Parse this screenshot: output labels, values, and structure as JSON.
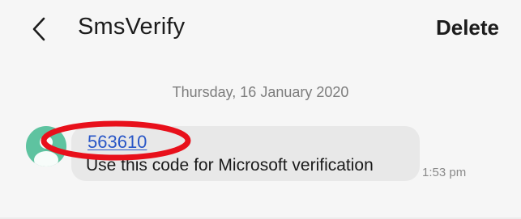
{
  "header": {
    "back_icon": "chevron-left-icon",
    "title": "SmsVerify",
    "delete_label": "Delete"
  },
  "conversation": {
    "date_divider": "Thursday, 16 January 2020",
    "messages": [
      {
        "sender_avatar_icon": "person-icon",
        "code": "563610",
        "text": "Use this code for Microsoft verification",
        "time": "1:53 pm"
      }
    ]
  },
  "annotation": {
    "type": "highlight-ellipse",
    "color": "#e8101b"
  },
  "colors": {
    "avatar": "#5ec3a0",
    "bubble": "#e8e8e8",
    "link": "#2856c7",
    "background": "#f6f6f6"
  }
}
